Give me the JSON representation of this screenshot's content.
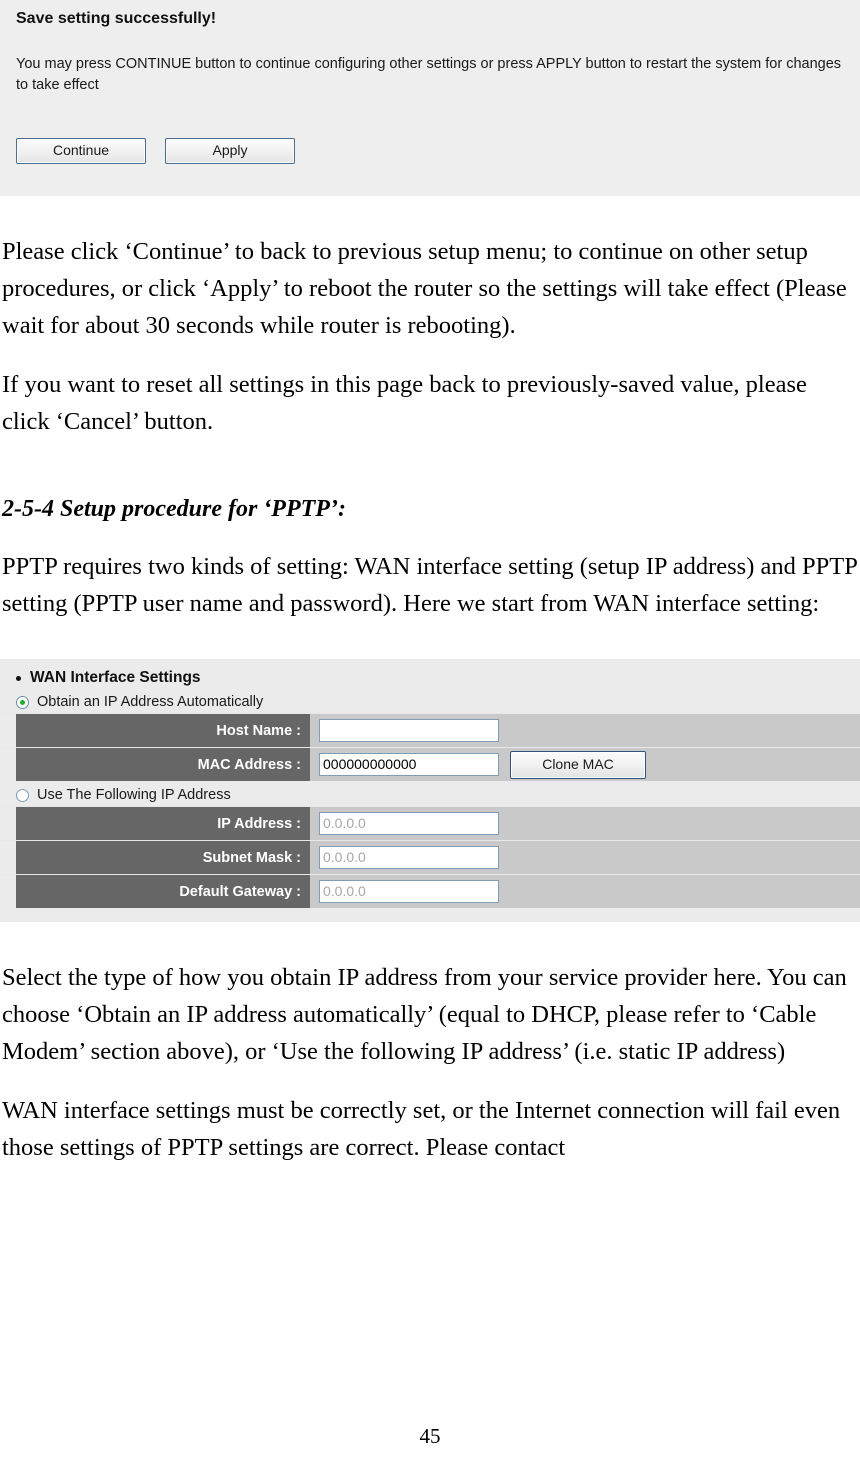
{
  "router_panel": {
    "title": "Save setting successfully!",
    "description": "You may press CONTINUE button to continue configuring other settings or press APPLY button to restart the system for changes to take effect",
    "continue_label": "Continue",
    "apply_label": "Apply",
    "background_color": "#eeeeee",
    "button_border_color": "#4a6d91"
  },
  "document": {
    "paragraph_1": "Please click ‘Continue’ to back to previous setup menu; to continue on other setup procedures, or click ‘Apply’ to reboot the router so the settings will take effect (Please wait for about 30 seconds while router is rebooting).",
    "paragraph_2": "If you want to reset all settings in this page back to previously-saved value, please click ‘Cancel’ button.",
    "section_heading": "2-5-4 Setup procedure for ‘PPTP’:",
    "paragraph_3": "PPTP requires two kinds of setting: WAN interface setting (setup IP address) and PPTP setting (PPTP user name and password). Here we start from WAN interface setting:",
    "paragraph_4": "Select the type of how you obtain IP address from your service provider here. You can choose ‘Obtain an IP address automatically’ (equal to DHCP, please refer to ‘Cable Modem’ section above), or ‘Use the following IP address’ (i.e. static IP address)",
    "paragraph_5": "WAN interface settings must be correctly set, or the Internet connection will fail even those settings of PPTP settings are correct. Please contact",
    "page_number": "45"
  },
  "wan_panel": {
    "title": "WAN Interface Settings",
    "radio_auto_label": "Obtain an IP Address Automatically",
    "radio_static_label": "Use The Following IP Address",
    "clone_mac_label": "Clone MAC",
    "label_cell_color": "#666666",
    "row_color": "#c9c9c9",
    "panel_color": "#ebebeb",
    "radio_dot_color": "#1faf2a",
    "fields": [
      {
        "label": "Host Name :",
        "value": "",
        "placeholder": "",
        "disabled": false
      },
      {
        "label": "MAC Address :",
        "value": "000000000000",
        "placeholder": "",
        "disabled": false
      },
      {
        "label": "IP Address :",
        "value": "0.0.0.0",
        "placeholder": "0.0.0.0",
        "disabled": true
      },
      {
        "label": "Subnet Mask :",
        "value": "0.0.0.0",
        "placeholder": "0.0.0.0",
        "disabled": true
      },
      {
        "label": "Default Gateway :",
        "value": "0.0.0.0",
        "placeholder": "0.0.0.0",
        "disabled": true
      }
    ]
  }
}
